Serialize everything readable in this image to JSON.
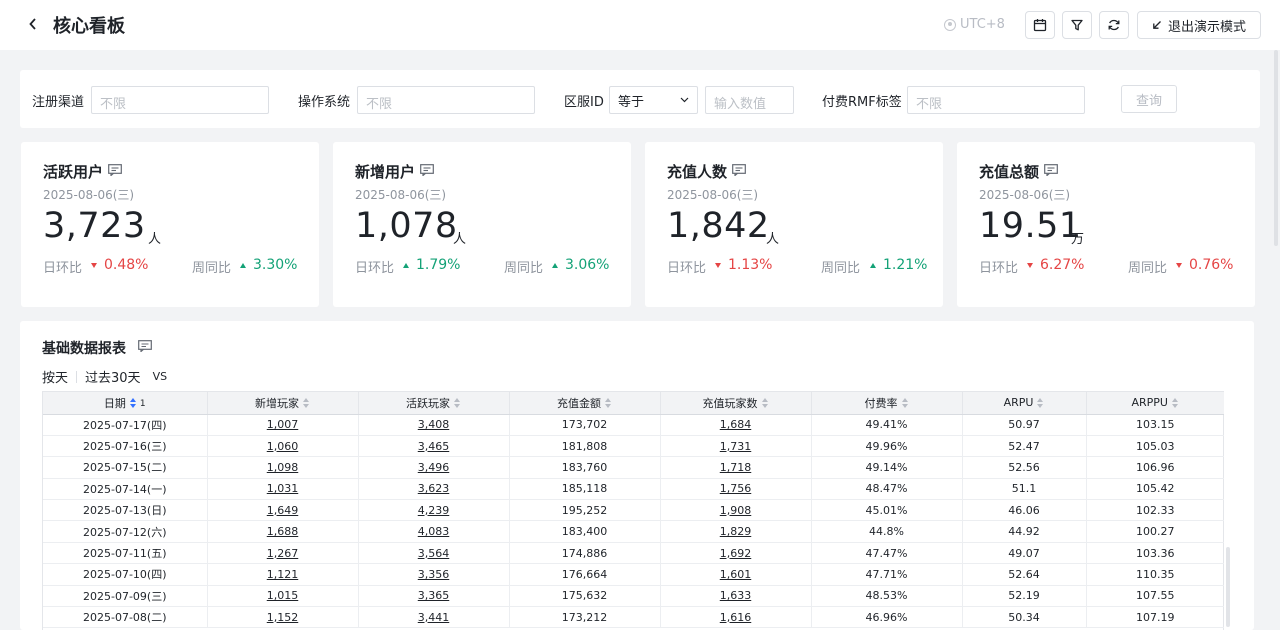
{
  "header": {
    "title": "核心看板",
    "timezone": "UTC+8",
    "exit_label": "退出演示模式"
  },
  "filters": {
    "channel_label": "注册渠道",
    "channel_placeholder": "不限",
    "os_label": "操作系统",
    "os_placeholder": "不限",
    "server_label": "区服ID",
    "server_operator": "等于",
    "server_placeholder": "输入数值",
    "rmf_label": "付费RMF标签",
    "rmf_placeholder": "不限",
    "query_label": "查询"
  },
  "cards": [
    {
      "title": "活跃用户",
      "date": "2025-08-06(三)",
      "value": "3,723",
      "unit": "人",
      "dod_label": "日环比",
      "dod": "0.48%",
      "dod_dir": "down",
      "wow_label": "周同比",
      "wow": "3.30%",
      "wow_dir": "up"
    },
    {
      "title": "新增用户",
      "date": "2025-08-06(三)",
      "value": "1,078",
      "unit": "人",
      "dod_label": "日环比",
      "dod": "1.79%",
      "dod_dir": "up",
      "wow_label": "周同比",
      "wow": "3.06%",
      "wow_dir": "up"
    },
    {
      "title": "充值人数",
      "date": "2025-08-06(三)",
      "value": "1,842",
      "unit": "人",
      "dod_label": "日环比",
      "dod": "1.13%",
      "dod_dir": "down",
      "wow_label": "周同比",
      "wow": "1.21%",
      "wow_dir": "up"
    },
    {
      "title": "充值总额",
      "date": "2025-08-06(三)",
      "value": "19.51",
      "unit": "万",
      "dod_label": "日环比",
      "dod": "6.27%",
      "dod_dir": "down",
      "wow_label": "周同比",
      "wow": "0.76%",
      "wow_dir": "down"
    }
  ],
  "report": {
    "title": "基础数据报表",
    "granularity": "按天",
    "range": "过去30天",
    "vs": "VS",
    "sort_index": "1",
    "columns": [
      "日期",
      "新增玩家",
      "活跃玩家",
      "充值金额",
      "充值玩家数",
      "付费率",
      "ARPU",
      "ARPPU"
    ],
    "rows": [
      [
        "2025-07-17(四)",
        "1,007",
        "3,408",
        "173,702",
        "1,684",
        "49.41%",
        "50.97",
        "103.15"
      ],
      [
        "2025-07-16(三)",
        "1,060",
        "3,465",
        "181,808",
        "1,731",
        "49.96%",
        "52.47",
        "105.03"
      ],
      [
        "2025-07-15(二)",
        "1,098",
        "3,496",
        "183,760",
        "1,718",
        "49.14%",
        "52.56",
        "106.96"
      ],
      [
        "2025-07-14(一)",
        "1,031",
        "3,623",
        "185,118",
        "1,756",
        "48.47%",
        "51.1",
        "105.42"
      ],
      [
        "2025-07-13(日)",
        "1,649",
        "4,239",
        "195,252",
        "1,908",
        "45.01%",
        "46.06",
        "102.33"
      ],
      [
        "2025-07-12(六)",
        "1,688",
        "4,083",
        "183,400",
        "1,829",
        "44.8%",
        "44.92",
        "100.27"
      ],
      [
        "2025-07-11(五)",
        "1,267",
        "3,564",
        "174,886",
        "1,692",
        "47.47%",
        "49.07",
        "103.36"
      ],
      [
        "2025-07-10(四)",
        "1,121",
        "3,356",
        "176,664",
        "1,601",
        "47.71%",
        "52.64",
        "110.35"
      ],
      [
        "2025-07-09(三)",
        "1,015",
        "3,365",
        "175,632",
        "1,633",
        "48.53%",
        "52.19",
        "107.55"
      ],
      [
        "2025-07-08(二)",
        "1,152",
        "3,441",
        "173,212",
        "1,616",
        "46.96%",
        "50.34",
        "107.19"
      ]
    ]
  },
  "colors": {
    "up": "#14a277",
    "down": "#e54545",
    "accent": "#3370ff"
  }
}
